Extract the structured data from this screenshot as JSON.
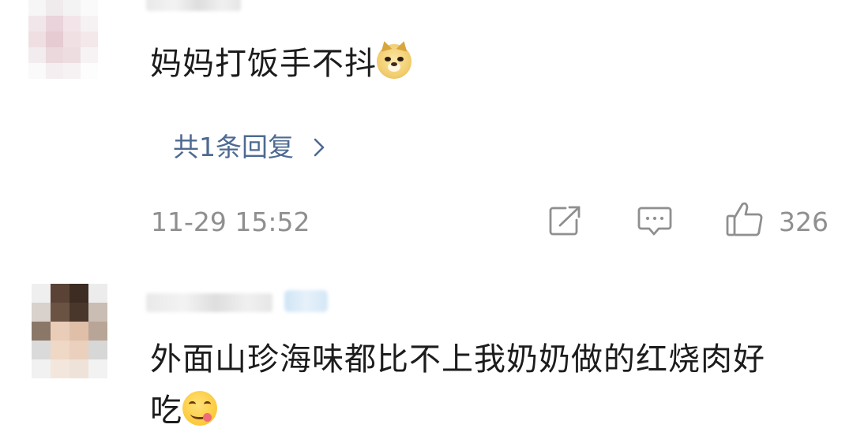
{
  "colors": {
    "text": "#1c1c1c",
    "link": "#4e6a92",
    "meta": "#8f8f8f",
    "background": "#ffffff"
  },
  "comments": [
    {
      "text": "妈妈打饭手不抖",
      "emoji": "doge-emoji",
      "replies_link": "共1条回复",
      "timestamp": "11-29 15:52",
      "like_count": "326",
      "icons": [
        "share-icon",
        "comment-icon",
        "like-icon",
        "chevron-right-icon"
      ]
    },
    {
      "text_line1": "外面山珍海味都比不上我奶奶做的红烧肉好",
      "text_line2": "吃",
      "emoji": "yum-face-emoji"
    }
  ]
}
